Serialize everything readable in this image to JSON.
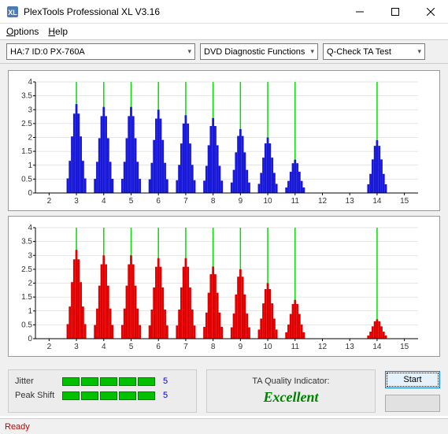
{
  "window": {
    "title": "PlexTools Professional XL V3.16"
  },
  "menu": {
    "options": "Options",
    "help": "Help"
  },
  "toolbar": {
    "device": "HA:7 ID:0  PX-760A",
    "func": "DVD Diagnostic Functions",
    "test": "Q-Check TA Test"
  },
  "bottom": {
    "jitter_label": "Jitter",
    "jitter_score": "5",
    "peak_label": "Peak Shift",
    "peak_score": "5",
    "tqi_label": "TA Quality Indicator:",
    "tqi_value": "Excellent",
    "start": "Start"
  },
  "status": "Ready",
  "chart_data": [
    {
      "type": "bar",
      "color": "#1818d8",
      "xlim": [
        1.5,
        15.5
      ],
      "ylim": [
        0,
        4
      ],
      "xticks": [
        2,
        3,
        4,
        5,
        6,
        7,
        8,
        9,
        10,
        11,
        12,
        13,
        14,
        15
      ],
      "yticks": [
        0,
        0.5,
        1,
        1.5,
        2,
        2.5,
        3,
        3.5,
        4
      ],
      "vlines": [
        3,
        4,
        5,
        6,
        7,
        8,
        9,
        10,
        11,
        14
      ],
      "peaks": [
        {
          "x": 3,
          "y": 3.2
        },
        {
          "x": 4,
          "y": 3.1
        },
        {
          "x": 5,
          "y": 3.1
        },
        {
          "x": 6,
          "y": 3.0
        },
        {
          "x": 7,
          "y": 2.8
        },
        {
          "x": 8,
          "y": 2.7
        },
        {
          "x": 9,
          "y": 2.3
        },
        {
          "x": 10,
          "y": 2.0
        },
        {
          "x": 11,
          "y": 1.2
        },
        {
          "x": 14,
          "y": 1.9
        }
      ]
    },
    {
      "type": "bar",
      "color": "#e00000",
      "xlim": [
        1.5,
        15.5
      ],
      "ylim": [
        0,
        4
      ],
      "xticks": [
        2,
        3,
        4,
        5,
        6,
        7,
        8,
        9,
        10,
        11,
        12,
        13,
        14,
        15
      ],
      "yticks": [
        0,
        0.5,
        1,
        1.5,
        2,
        2.5,
        3,
        3.5,
        4
      ],
      "vlines": [
        3,
        4,
        5,
        6,
        7,
        8,
        9,
        10,
        11,
        14
      ],
      "peaks": [
        {
          "x": 3,
          "y": 3.2
        },
        {
          "x": 4,
          "y": 3.0
        },
        {
          "x": 5,
          "y": 3.0
        },
        {
          "x": 6,
          "y": 2.9
        },
        {
          "x": 7,
          "y": 2.9
        },
        {
          "x": 8,
          "y": 2.6
        },
        {
          "x": 9,
          "y": 2.5
        },
        {
          "x": 10,
          "y": 2.0
        },
        {
          "x": 11,
          "y": 1.4
        },
        {
          "x": 14,
          "y": 0.7
        }
      ]
    }
  ]
}
